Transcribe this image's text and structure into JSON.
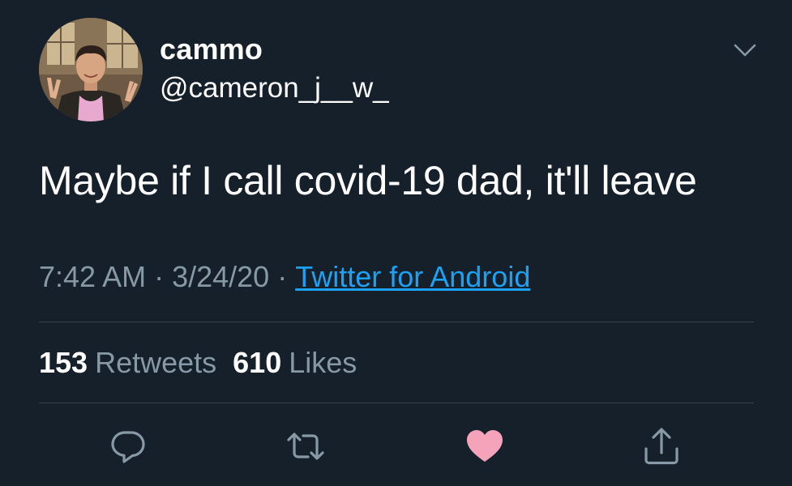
{
  "user": {
    "display_name": "cammo",
    "handle": "@cameron_j__w_"
  },
  "tweet": {
    "text": "Maybe if I call covid-19 dad, it'll leave",
    "time": "7:42 AM",
    "date": "3/24/20",
    "separator": "·",
    "source": "Twitter for Android"
  },
  "stats": {
    "retweets_count": "153",
    "retweets_label": "Retweets",
    "likes_count": "610",
    "likes_label": "Likes"
  },
  "actions": {
    "reply_icon": "reply-icon",
    "retweet_icon": "retweet-icon",
    "like_icon": "heart-icon",
    "share_icon": "share-icon",
    "menu_icon": "chevron-down-icon"
  },
  "colors": {
    "background": "#15202b",
    "text_primary": "#ffffff",
    "text_secondary": "#8899a6",
    "link": "#1da1f2",
    "divider": "#38444d",
    "like_active": "#f4a3bb"
  }
}
